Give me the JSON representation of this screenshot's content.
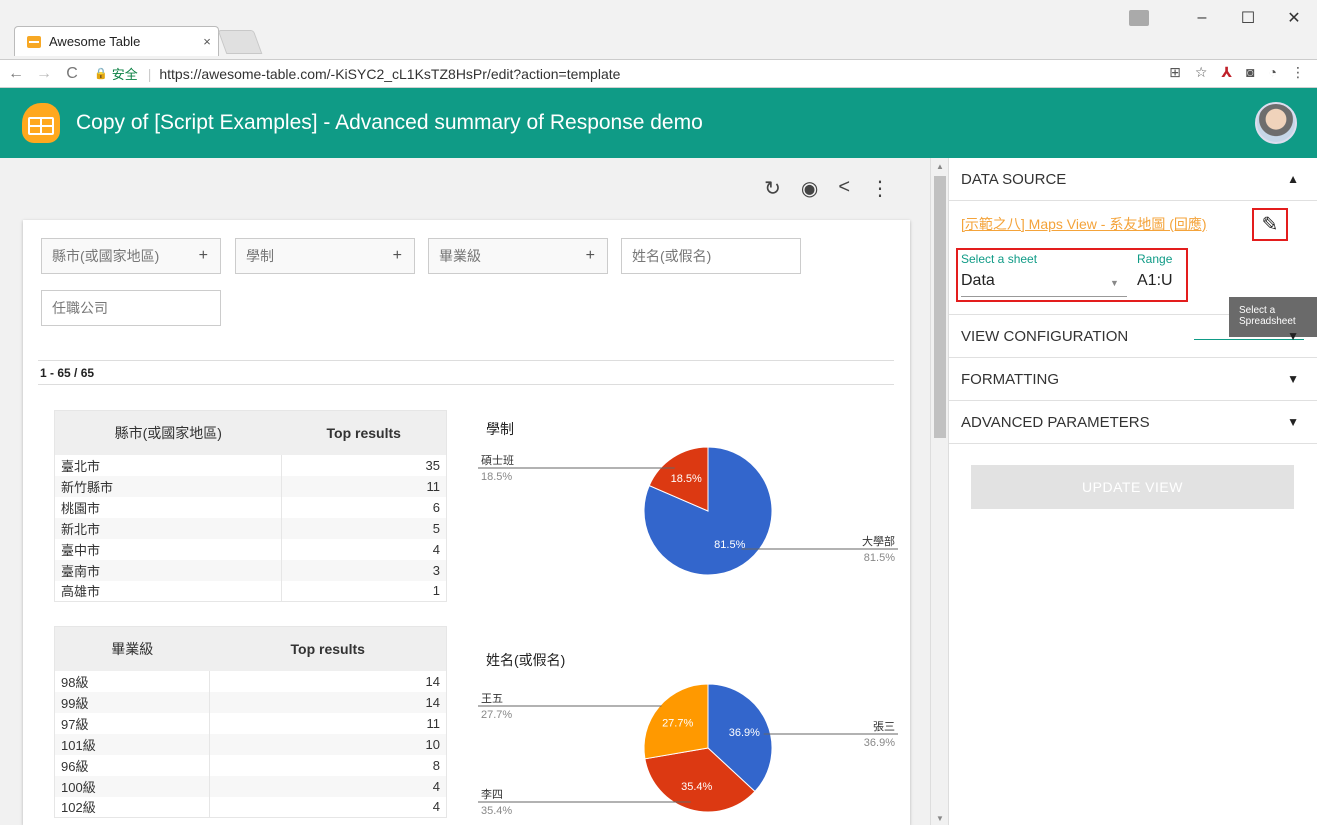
{
  "browser": {
    "tab_title": "Awesome Table",
    "tab_close": "×",
    "secure_label": "安全",
    "url": "https://awesome-table.com/-KiSYC2_cL1KsTZ8HsPr/edit?action=template",
    "window_controls": {
      "minimize": "–",
      "maximize": "☐",
      "close": "✕"
    }
  },
  "app": {
    "title": "Copy of [Script Examples] - Advanced summary of Response demo"
  },
  "filters": {
    "city": "縣市(或國家地區)",
    "school": "學制",
    "grad": "畢業級",
    "name_placeholder": "姓名(或假名)",
    "company_placeholder": "任職公司",
    "plus": "+"
  },
  "results": {
    "count": "1 - 65 / 65"
  },
  "table_city": {
    "header": "縣市(或國家地區)",
    "header_right": "Top results",
    "rows": [
      {
        "label": "臺北市",
        "value": "35"
      },
      {
        "label": "新竹縣市",
        "value": "11"
      },
      {
        "label": "桃園市",
        "value": "6"
      },
      {
        "label": "新北市",
        "value": "5"
      },
      {
        "label": "臺中市",
        "value": "4"
      },
      {
        "label": "臺南市",
        "value": "3"
      },
      {
        "label": "高雄市",
        "value": "1"
      }
    ]
  },
  "table_grad": {
    "header": "畢業級",
    "header_right": "Top results",
    "rows": [
      {
        "label": "98級",
        "value": "14"
      },
      {
        "label": "99級",
        "value": "14"
      },
      {
        "label": "97級",
        "value": "11"
      },
      {
        "label": "101級",
        "value": "10"
      },
      {
        "label": "96級",
        "value": "8"
      },
      {
        "label": "100級",
        "value": "4"
      },
      {
        "label": "102級",
        "value": "4"
      }
    ]
  },
  "chart_data": [
    {
      "type": "pie",
      "title": "學制",
      "slices": [
        {
          "label": "大學部",
          "percent": 81.5,
          "pct_label": "81.5%",
          "color": "#3366cc"
        },
        {
          "label": "碩士班",
          "percent": 18.5,
          "pct_label": "18.5%",
          "color": "#dc3912"
        }
      ]
    },
    {
      "type": "pie",
      "title": "姓名(或假名)",
      "slices": [
        {
          "label": "張三",
          "percent": 36.9,
          "pct_label": "36.9%",
          "color": "#3366cc"
        },
        {
          "label": "李四",
          "percent": 35.4,
          "pct_label": "35.4%",
          "color": "#dc3912"
        },
        {
          "label": "王五",
          "percent": 27.7,
          "pct_label": "27.7%",
          "color": "#ff9900"
        }
      ]
    }
  ],
  "panel": {
    "data_source": "DATA SOURCE",
    "spreadsheet_link": "[示範之八] Maps View - 系友地圖 (回應)",
    "select_sheet_label": "Select a sheet",
    "sheet_value": "Data",
    "range_label": "Range",
    "range_value": "A1:U",
    "tooltip": "Select a Spreadsheet",
    "view_config": "VIEW CONFIGURATION",
    "formatting": "FORMATTING",
    "advanced": "ADVANCED PARAMETERS",
    "update_button": "UPDATE VIEW"
  },
  "colors": {
    "header": "#0f9b86",
    "accent_link": "#f4a33a",
    "highlight_box": "#e31d1d"
  }
}
